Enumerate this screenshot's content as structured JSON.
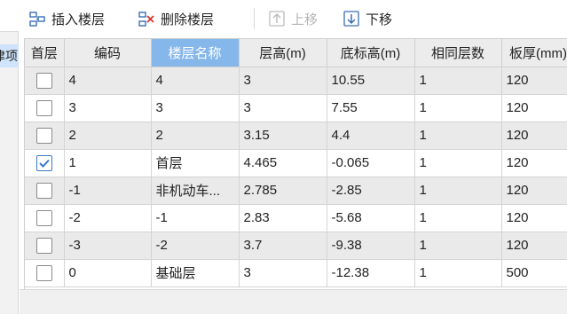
{
  "left_panel": {
    "selected_item_fragment": "津项"
  },
  "toolbar": {
    "insert_label": "插入楼层",
    "delete_label": "删除楼层",
    "up_label": "上移",
    "down_label": "下移"
  },
  "table": {
    "columns": [
      "首层",
      "编码",
      "楼层名称",
      "层高(m)",
      "底标高(m)",
      "相同层数",
      "板厚(mm)"
    ],
    "active_column": "楼层名称",
    "rows": [
      {
        "first_floor": false,
        "code": "4",
        "name": "4",
        "height": "3",
        "bottom": "10.55",
        "same": "1",
        "slab": "120"
      },
      {
        "first_floor": false,
        "code": "3",
        "name": "3",
        "height": "3",
        "bottom": "7.55",
        "same": "1",
        "slab": "120"
      },
      {
        "first_floor": false,
        "code": "2",
        "name": "2",
        "height": "3.15",
        "bottom": "4.4",
        "same": "1",
        "slab": "120"
      },
      {
        "first_floor": true,
        "code": "1",
        "name": "首层",
        "height": "4.465",
        "bottom": "-0.065",
        "same": "1",
        "slab": "120"
      },
      {
        "first_floor": false,
        "code": "-1",
        "name": "非机动车...",
        "height": "2.785",
        "bottom": "-2.85",
        "same": "1",
        "slab": "120"
      },
      {
        "first_floor": false,
        "code": "-2",
        "name": "-1",
        "height": "2.83",
        "bottom": "-5.68",
        "same": "1",
        "slab": "120"
      },
      {
        "first_floor": false,
        "code": "-3",
        "name": "-2",
        "height": "3.7",
        "bottom": "-9.38",
        "same": "1",
        "slab": "120"
      },
      {
        "first_floor": false,
        "code": "0",
        "name": "基础层",
        "height": "3",
        "bottom": "-12.38",
        "same": "1",
        "slab": "500"
      }
    ]
  },
  "colors": {
    "header_active": "#86b7ea",
    "row_alt": "#eaeaea",
    "check": "#3c78c8"
  }
}
